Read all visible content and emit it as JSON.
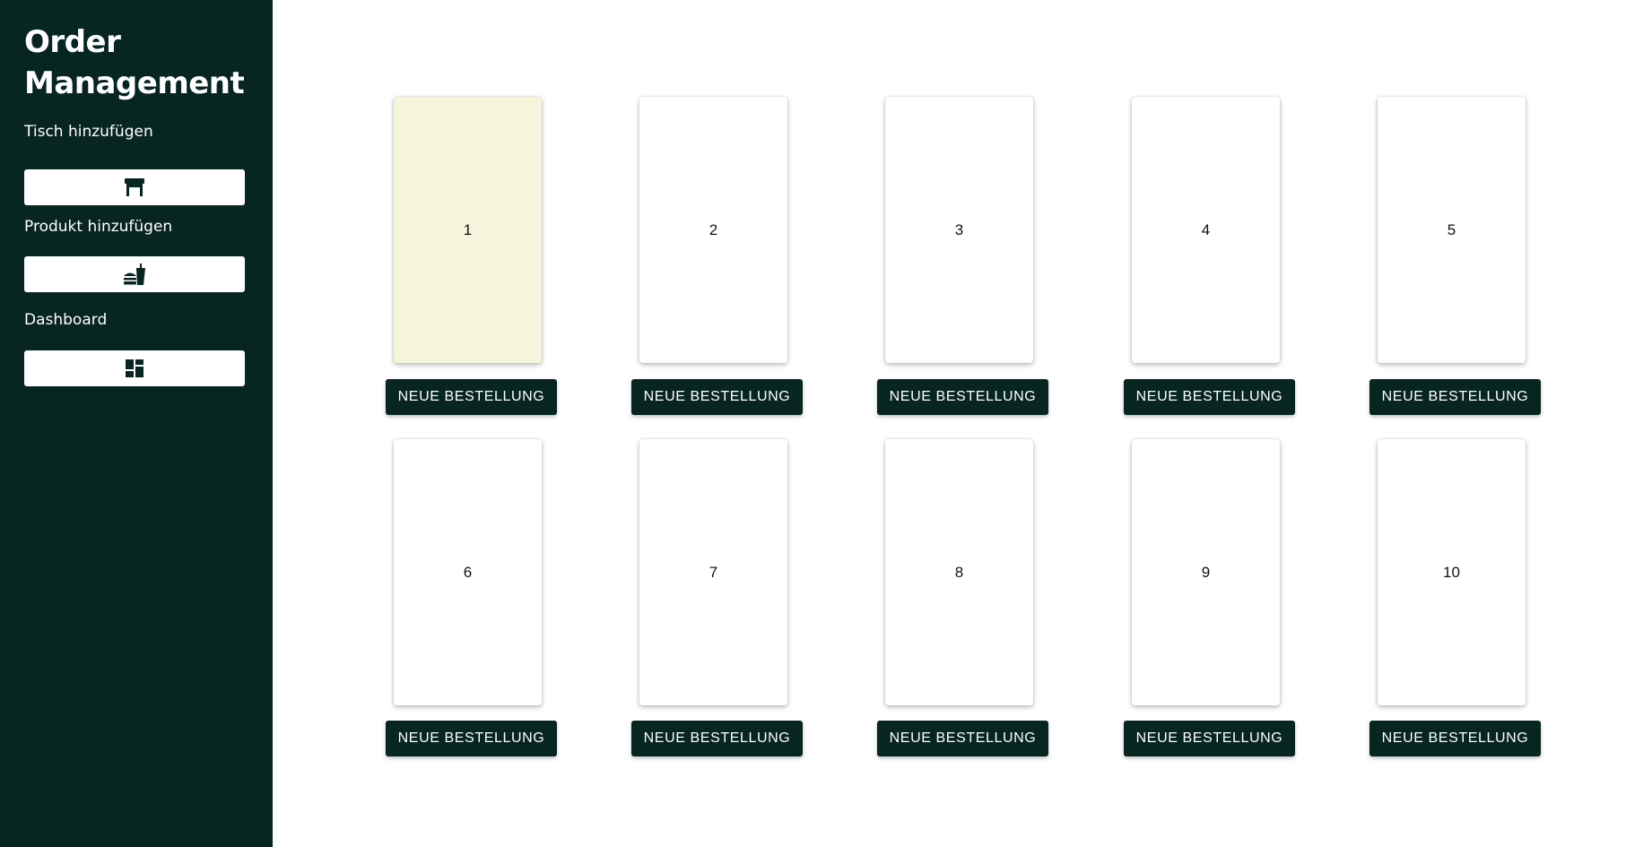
{
  "sidebar": {
    "title": "Order Management",
    "items": [
      {
        "label": "Tisch hinzufügen",
        "icon": "table-icon"
      },
      {
        "label": "Produkt hinzufügen",
        "icon": "fastfood-icon"
      },
      {
        "label": "Dashboard",
        "icon": "dashboard-icon"
      }
    ]
  },
  "tables": [
    {
      "number": "1",
      "button_label": "NEUE BESTELLUNG",
      "highlighted": true
    },
    {
      "number": "2",
      "button_label": "NEUE BESTELLUNG",
      "highlighted": false
    },
    {
      "number": "3",
      "button_label": "NEUE BESTELLUNG",
      "highlighted": false
    },
    {
      "number": "4",
      "button_label": "NEUE BESTELLUNG",
      "highlighted": false
    },
    {
      "number": "5",
      "button_label": "NEUE BESTELLUNG",
      "highlighted": false
    },
    {
      "number": "6",
      "button_label": "NEUE BESTELLUNG",
      "highlighted": false
    },
    {
      "number": "7",
      "button_label": "NEUE BESTELLUNG",
      "highlighted": false
    },
    {
      "number": "8",
      "button_label": "NEUE BESTELLUNG",
      "highlighted": false
    },
    {
      "number": "9",
      "button_label": "NEUE BESTELLUNG",
      "highlighted": false
    },
    {
      "number": "10",
      "button_label": "NEUE BESTELLUNG",
      "highlighted": false
    }
  ],
  "colors": {
    "sidebar_bg": "#072521",
    "button_bg": "#072521",
    "highlight_card": "#f5f5dc",
    "card_bg": "#ffffff"
  }
}
